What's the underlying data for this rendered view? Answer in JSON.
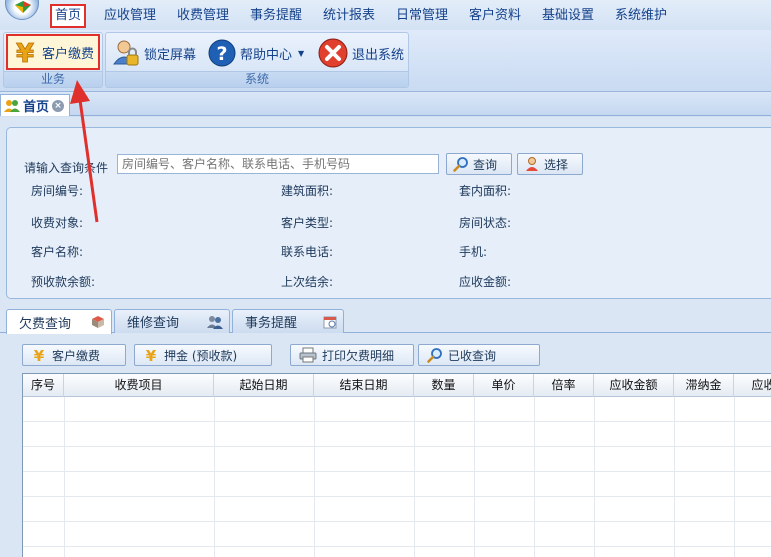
{
  "menu": {
    "items": [
      "首页",
      "应收管理",
      "收费管理",
      "事务提醒",
      "统计报表",
      "日常管理",
      "客户资料",
      "基础设置",
      "系统维护"
    ],
    "active_index": 0
  },
  "ribbon": {
    "business_group": {
      "label": "业务",
      "buttons": [
        {
          "label": "客户缴费",
          "icon": "yen-icon"
        }
      ]
    },
    "system_group": {
      "label": "系统",
      "buttons": [
        {
          "label": "锁定屏幕",
          "icon": "lock-user-icon"
        },
        {
          "label": "帮助中心",
          "icon": "help-icon"
        },
        {
          "label": "退出系统",
          "icon": "exit-icon"
        }
      ]
    }
  },
  "doc_tab": {
    "label": "首页"
  },
  "query": {
    "label": "请输入查询条件",
    "placeholder": "房间编号、客户名称、联系电话、手机号码",
    "search_button": "查询",
    "select_button": "选择"
  },
  "fields": {
    "room_no": "房间编号:",
    "building_area": "建筑面积:",
    "inner_area": "套内面积:",
    "charge_target": "收费对象:",
    "customer_type": "客户类型:",
    "room_status": "房间状态:",
    "customer_name": "客户名称:",
    "phone": "联系电话:",
    "mobile": "手机:",
    "prepaid_balance": "预收款余额:",
    "last_settlement": "上次结余:",
    "receivable": "应收金额:"
  },
  "sub_tabs": [
    {
      "label": "欠费查询",
      "icon": "cube-icon"
    },
    {
      "label": "维修查询",
      "icon": "users-icon"
    },
    {
      "label": "事务提醒",
      "icon": "calendar-icon"
    }
  ],
  "toolbar": {
    "pay": "客户缴费",
    "deposit": "押金 (预收款)",
    "print": "打印欠费明细",
    "paid_query": "已收查询"
  },
  "grid": {
    "columns": [
      "序号",
      "收费项目",
      "起始日期",
      "结束日期",
      "数量",
      "单价",
      "倍率",
      "应收金额",
      "滞纳金",
      "应收"
    ]
  },
  "colors": {
    "highlight": "#e0302c",
    "ribbon": "#dfeafa",
    "text": "#15428b"
  }
}
